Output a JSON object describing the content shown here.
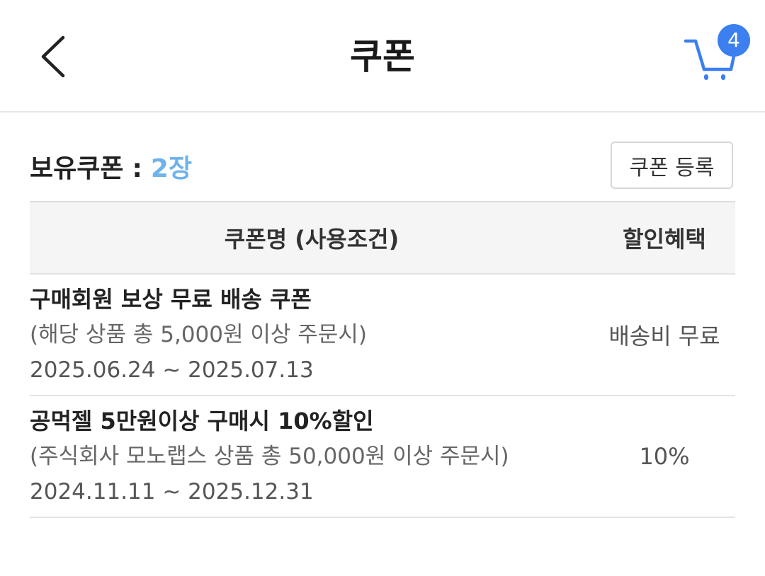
{
  "header": {
    "title": "쿠폰",
    "cart_count": "4"
  },
  "summary": {
    "label": "보유쿠폰",
    "colon": ":",
    "count": "2장",
    "register_label": "쿠폰 등록"
  },
  "table": {
    "columns": [
      "쿠폰명 (사용조건)",
      "할인혜택"
    ],
    "rows": [
      {
        "title": "구매회원 보상 무료 배송 쿠폰",
        "condition": "(해당 상품 총 5,000원 이상 주문시)",
        "period": "2025.06.24 ~ 2025.07.13",
        "benefit": "배송비 무료"
      },
      {
        "title": "공먹젤 5만원이상 구매시 10%할인",
        "condition": "(주식회사 모노랩스 상품 총 50,000원 이상 주문시)",
        "period": "2024.11.11 ~ 2025.12.31",
        "benefit": "10%"
      }
    ]
  },
  "icons": {
    "back": "chevron-left-icon",
    "cart": "cart-icon"
  },
  "colors": {
    "accent": "#3b7ff0",
    "count_text": "#6fb3ec"
  }
}
